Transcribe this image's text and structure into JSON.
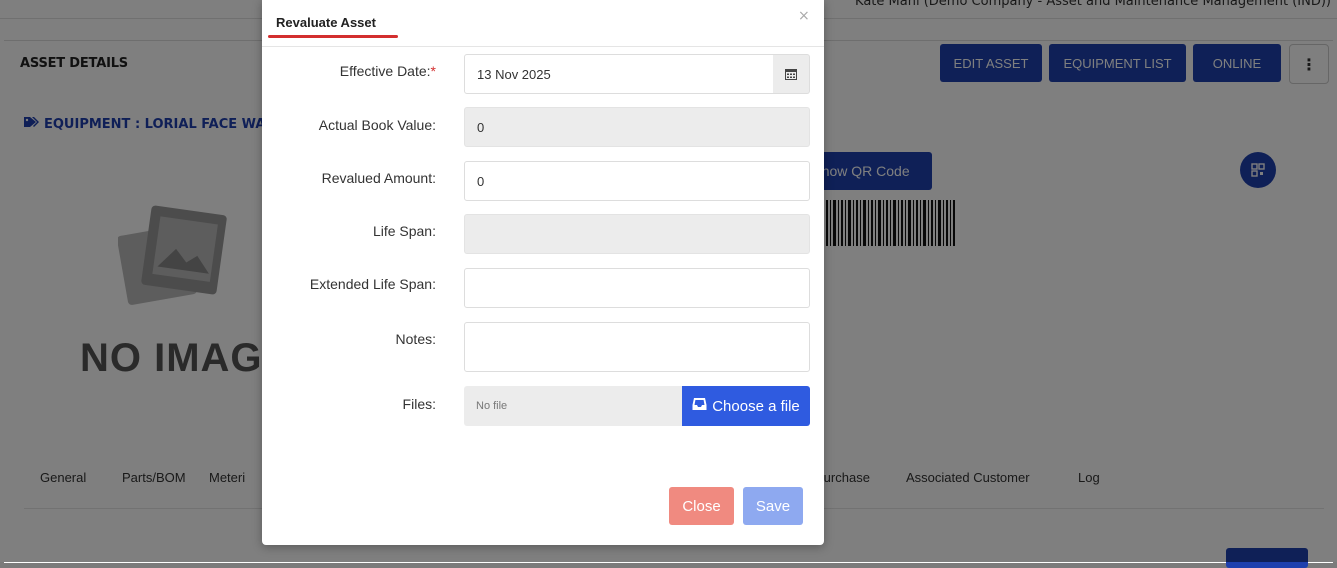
{
  "topbar": {
    "user_text": "Kate Mani (Demo Company - Asset and Maintenance Management (IND))"
  },
  "page": {
    "title": "ASSET DETAILS",
    "buttons": {
      "edit": "EDIT ASSET",
      "equipment_list": "EQUIPMENT LIST",
      "online": "ONLINE",
      "menu": "⋮"
    },
    "equipment_title": "EQUIPMENT : LORIAL FACE WA",
    "no_image": "NO IMAGE",
    "qr_button": "Show QR Code",
    "tabs": [
      "General",
      "Parts/BOM",
      "Meteri",
      "Purchase",
      "Associated Customer",
      "Log"
    ]
  },
  "modal": {
    "title": "Revaluate Asset",
    "close_x": "×",
    "fields": {
      "effective_date": {
        "label": "Effective Date:",
        "required_mark": "*",
        "value": "13 Nov 2025"
      },
      "actual_book_value": {
        "label": "Actual Book Value:",
        "value": "0"
      },
      "revalued_amount": {
        "label": "Revalued Amount:",
        "value": "0"
      },
      "life_span": {
        "label": "Life Span:",
        "value": ""
      },
      "extended_life_span": {
        "label": "Extended Life Span:",
        "value": ""
      },
      "notes": {
        "label": "Notes:",
        "value": ""
      },
      "files": {
        "label": "Files:",
        "placeholder": "No file",
        "button": "Choose a file"
      }
    },
    "buttons": {
      "close": "Close",
      "save": "Save"
    }
  },
  "colors": {
    "primary": "#1e40ae",
    "file_button": "#2f5be0",
    "close_button": "#f08a80",
    "save_button": "#8ea9f0",
    "required": "#d32f2f"
  },
  "icons": {
    "calendar": "calendar-icon",
    "tag": "tag-icon",
    "inbox": "inbox-icon",
    "qr": "qr-code-icon",
    "close": "close-icon"
  }
}
